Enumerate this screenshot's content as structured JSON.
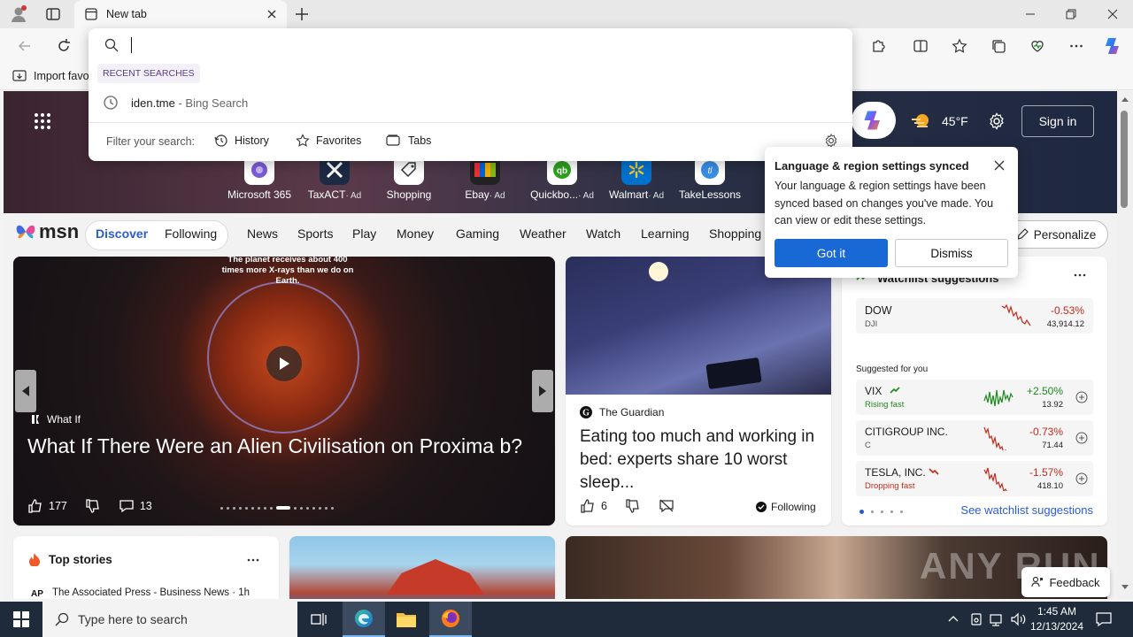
{
  "browser": {
    "tab_title": "New tab",
    "address_value": "",
    "favorites_item": "Import favo"
  },
  "omnibox": {
    "recent_header": "RECENT SEARCHES",
    "recent_query": "iden.tme",
    "recent_source": " - Bing Search",
    "filter_label": "Filter your search:",
    "filters": [
      "History",
      "Favorites",
      "Tabs"
    ]
  },
  "msn_header": {
    "weather": "45°F",
    "signin": "Sign in"
  },
  "quicklinks": [
    {
      "label": "Microsoft 365",
      "ad": ""
    },
    {
      "label": "TaxACT",
      "ad": "· Ad"
    },
    {
      "label": "Shopping",
      "ad": ""
    },
    {
      "label": "Ebay",
      "ad": "· Ad"
    },
    {
      "label": "Quickbo...",
      "ad": "· Ad"
    },
    {
      "label": "Walmart",
      "ad": "· Ad"
    },
    {
      "label": "TakeLessons",
      "ad": ""
    }
  ],
  "nav": {
    "logo": "msn",
    "tabs": [
      "Discover",
      "Following"
    ],
    "categories": [
      "News",
      "Sports",
      "Play",
      "Money",
      "Gaming",
      "Weather",
      "Watch",
      "Learning",
      "Shopping"
    ],
    "personalize": "Personalize"
  },
  "hero": {
    "overlay_text": "The planet receives about 400 times more X-rays than we do on Earth.",
    "source": "What If",
    "title": "What If There Were an Alien Civilisation on Proxima b?",
    "likes": "177",
    "comments": "13"
  },
  "article": {
    "source": "The Guardian",
    "title": "Eating too much and working in bed: experts share 10 worst sleep...",
    "likes": "6",
    "following": "Following"
  },
  "watchlist": {
    "title": "Watchlist suggestions",
    "index": {
      "name": "DOW",
      "sub": "DJI",
      "change": "-0.53%",
      "price": "43,914.12"
    },
    "suggested_label": "Suggested for you",
    "items": [
      {
        "name": "VIX",
        "sub": "Rising fast",
        "change": "+2.50%",
        "price": "13.92",
        "color": "#1e8a1e"
      },
      {
        "name": "CITIGROUP INC.",
        "sub": "C",
        "change": "-0.73%",
        "price": "71.44",
        "color": "#c42b1c"
      },
      {
        "name": "TESLA, INC.",
        "sub": "Dropping fast",
        "change": "-1.57%",
        "price": "418.10",
        "color": "#c42b1c"
      }
    ],
    "see_link": "See watchlist suggestions"
  },
  "popup": {
    "title": "Language & region settings synced",
    "body": "Your language & region settings have been synced based on changes you've made. You can view or edit these settings.",
    "primary": "Got it",
    "secondary": "Dismiss"
  },
  "top_stories": {
    "title": "Top stories",
    "first_source": "The Associated Press - Business News · 1h"
  },
  "feedback": "Feedback",
  "watermark": "ANY RUN",
  "taskbar": {
    "search_placeholder": "Type here to search",
    "time": "1:45 AM",
    "date": "12/13/2024"
  }
}
